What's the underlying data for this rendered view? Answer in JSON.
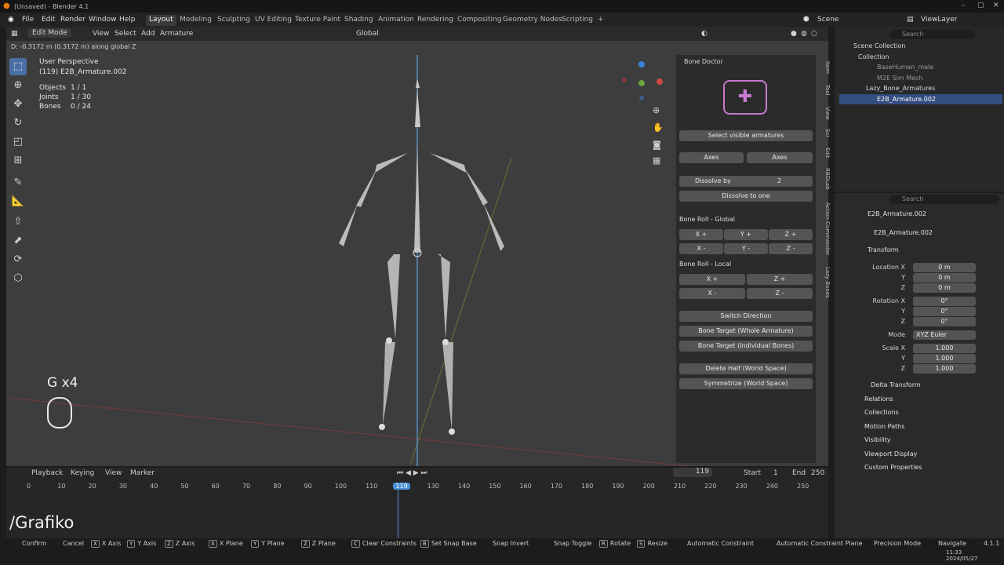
{
  "window": {
    "title": "(Unsaved) - Blender 4.1"
  },
  "menu": [
    "File",
    "Edit",
    "Render",
    "Window",
    "Help"
  ],
  "workspaces": [
    "Layout",
    "Modeling",
    "Sculpting",
    "UV Editing",
    "Texture Paint",
    "Shading",
    "Animation",
    "Rendering",
    "Compositing",
    "Geometry Nodes",
    "Scripting"
  ],
  "active_workspace": "Layout",
  "scene": {
    "label": "Scene",
    "view_layer": "ViewLayer"
  },
  "view_header": {
    "mode": "Edit Mode",
    "items": [
      "View",
      "Select",
      "Add",
      "Armature"
    ],
    "orientation": "Global"
  },
  "hint": "D: -0.3172 m (0.3172 m) along global Z",
  "viewport": {
    "perspective": "User Perspective",
    "object": "(119) E2B_Armature.002",
    "stats": [
      {
        "label": "Objects",
        "value": "1 / 1"
      },
      {
        "label": "Joints",
        "value": "1 / 30"
      },
      {
        "label": "Bones",
        "value": "0 / 24"
      }
    ]
  },
  "bone_doctor": {
    "title": "Bone Doctor",
    "select_visible": "Select visible armatures",
    "axes1": "Axes",
    "axes2": "Axes",
    "dissolve_by_label": "Dissolve by",
    "dissolve_by_value": "2",
    "dissolve_to_one": "Dissolve to one",
    "roll_global": "Bone Roll - Global",
    "roll_local": "Bone Roll - Local",
    "switch_direction": "Switch Direction",
    "bone_target_whole": "Bone Target (Whole Armature)",
    "bone_target_individual": "Bone Target (Individual Bones)",
    "delete_half": "Delete Half (World Space)",
    "symmetrize": "Symmetrize (World Space)",
    "axis_letters": [
      "X",
      "Y",
      "Z"
    ],
    "plus": "+",
    "minus": "-"
  },
  "side_tabs": [
    "Item",
    "Tool",
    "View",
    "Scr",
    "Edit",
    "RBDLab",
    "Action Commander",
    "Lazy Bones"
  ],
  "outliner": {
    "search": "Search",
    "items": [
      "Scene Collection",
      "Collection",
      "BaseHuman_male",
      "M2E Sim Mesh",
      "Lazy_Bone_Armatures",
      "E2B_Armature.002"
    ]
  },
  "properties": {
    "search": "Search",
    "object": "E2B_Armature.002",
    "data": "E2B_Armature.002",
    "transform": "Transform",
    "location_label": "Location X",
    "location": [
      "0 m",
      "0 m",
      "0 m"
    ],
    "rotation_label": "Rotation X",
    "rotation": [
      "0°",
      "0°",
      "0°"
    ],
    "mode_label": "Mode",
    "mode": "XYZ Euler",
    "scale_label": "Scale X",
    "scale": [
      "1.000",
      "1.000",
      "1.000"
    ],
    "y": "Y",
    "z": "Z",
    "sections": [
      "Delta Transform",
      "Relations",
      "Collections",
      "Motion Paths",
      "Visibility",
      "Viewport Display",
      "Custom Properties"
    ]
  },
  "timeline": {
    "menus": [
      "Playback",
      "Keying",
      "View",
      "Marker"
    ],
    "current_frame": "119",
    "start_label": "Start",
    "start": "1",
    "end_label": "End",
    "end": "250",
    "ticks": [
      "0",
      "10",
      "20",
      "30",
      "40",
      "50",
      "60",
      "70",
      "80",
      "90",
      "100",
      "110",
      "119",
      "130",
      "140",
      "150",
      "160",
      "170",
      "180",
      "190",
      "200",
      "210",
      "220",
      "230",
      "240",
      "250"
    ]
  },
  "status": [
    "Confirm",
    "Cancel",
    "X Axis",
    "Y Axis",
    "Z Axis",
    "X Plane",
    "Y Plane",
    "Z Plane",
    "Clear Constraints",
    "Set Snap Base",
    "Snap Invert",
    "Snap Toggle",
    "Rotate",
    "Resize",
    "Automatic Constraint",
    "Automatic Constraint Plane",
    "Precision Mode",
    "Navigate"
  ],
  "status_keys": [
    "X",
    "Y",
    "Z",
    "X",
    "Y",
    "Z",
    "C",
    "B",
    "R",
    "S"
  ],
  "version": "4.1.1",
  "datetime": "2024/05/27",
  "time": "11:33",
  "overlay": {
    "keys": "G x4",
    "brand": "/Grafiko"
  }
}
